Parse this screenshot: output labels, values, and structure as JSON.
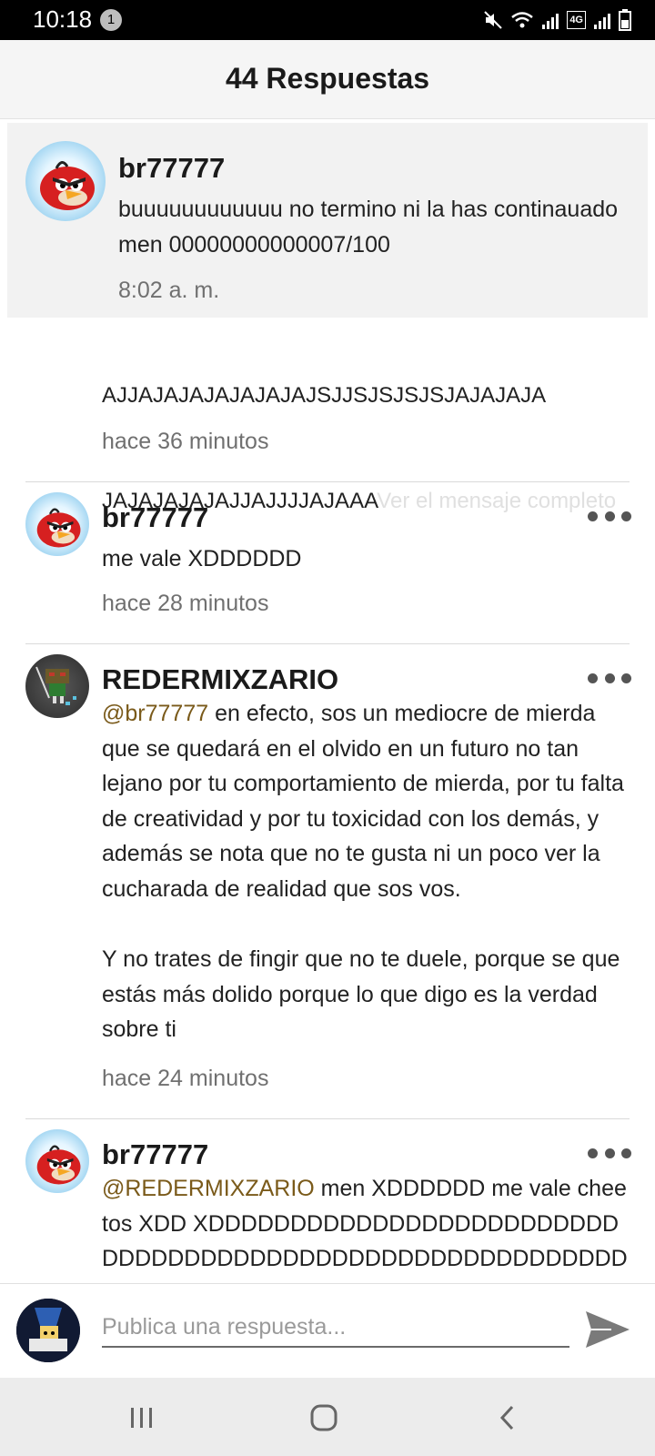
{
  "status_bar": {
    "time": "10:18",
    "notification_count": "1",
    "network_label": "4G"
  },
  "header": {
    "title": "44 Respuestas"
  },
  "pinned": {
    "author": "br77777",
    "text": "buuuuuuuuuuuu no termino ni la has continauado  men 00000000000007/100",
    "time": "8:02 a. m."
  },
  "replies": [
    {
      "text_line1": "AJJAJAJAJAJAJAJAJSJJSJSJSJSJAJAJAJA",
      "text_line2": "JAJAJAJAJAJJAJJJJAJAAA",
      "more_link": "Ver el mensaje completo",
      "time": "hace 36 minutos"
    },
    {
      "author": "br77777",
      "text": "me vale XDDDDDD",
      "time": "hace 28 minutos"
    },
    {
      "author": "REDERMIXZARIO",
      "mention": "@br77777",
      "text": " en efecto, sos un mediocre de mierda que se quedará en el olvido en un futuro no tan lejano por tu comportamiento de mierda, por tu falta de creatividad y por tu toxicidad con los demás, y además se nota que no te gusta ni un poco ver la cucharada de realidad que sos vos.\n\nY no trates de fingir que no te duele, porque se que estás más dolido porque lo que digo es la verdad sobre ti",
      "time": "hace 24 minutos"
    },
    {
      "author": "br77777",
      "mention": "@REDERMIXZARIO",
      "text": " men XDDDDDD me vale cheetos XDD XDDDDDDDDDDDDDDDDDDDDDDDDDDDDDDDDDDDDDDDDDDDDDDDDDDDDDDDDDDD"
    }
  ],
  "composer": {
    "placeholder": "Publica una respuesta..."
  },
  "colors": {
    "mention": "#7a5a1a",
    "header_bg": "#f5f5f5",
    "pinned_bg": "#f2f2f2"
  }
}
